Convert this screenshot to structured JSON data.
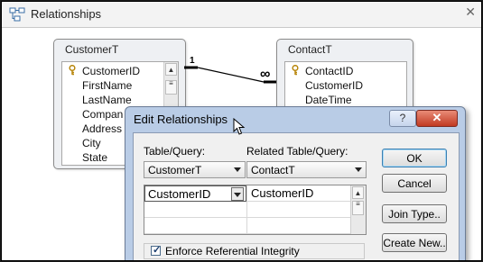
{
  "window": {
    "title": "Relationships",
    "close": "✕"
  },
  "tables": {
    "customer": {
      "title": "CustomerT",
      "fields": [
        "CustomerID",
        "FirstName",
        "LastName",
        "Compan",
        "Address",
        "City",
        "State"
      ]
    },
    "contact": {
      "title": "ContactT",
      "fields": [
        "ContactID",
        "CustomerID",
        "DateTime"
      ]
    }
  },
  "relationship_line": {
    "one_label": "1",
    "many_label": "∞"
  },
  "dialog": {
    "title": "Edit Relationships",
    "help_label": "?",
    "close_label": "✕",
    "table_query_label": "Table/Query:",
    "related_label": "Related Table/Query:",
    "table_query_value": "CustomerT",
    "related_value": "ContactT",
    "grid_left": "CustomerID",
    "grid_right": "CustomerID",
    "buttons": {
      "ok": "OK",
      "cancel": "Cancel",
      "join_type": "Join Type..",
      "create_new": "Create New.."
    },
    "enforce_label": "Enforce Referential Integrity",
    "enforce_checked": true
  }
}
